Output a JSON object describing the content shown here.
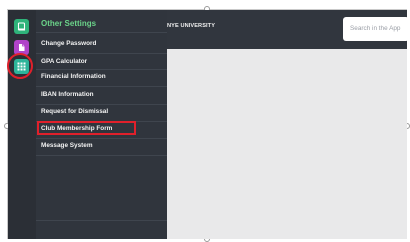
{
  "topbar": {
    "university_name": "NYE UNIVERSITY",
    "search_placeholder": "Search in the App"
  },
  "rail": {
    "buttons": [
      {
        "icon": "book-icon",
        "color": "#2fb37a"
      },
      {
        "icon": "document-icon",
        "color": "#b044c9"
      },
      {
        "icon": "apps-grid-icon",
        "color": "#2db59a",
        "highlighted": true
      }
    ]
  },
  "menu": {
    "header": "Other Settings",
    "items": [
      {
        "label": "Change Password"
      },
      {
        "label": "GPA Calculator"
      },
      {
        "label": "Financial Information"
      },
      {
        "label": "IBAN Information"
      },
      {
        "label": "Request for Dismissal"
      },
      {
        "label": "Club Membership Form",
        "highlighted": true
      },
      {
        "label": "Message System"
      }
    ]
  },
  "colors": {
    "rail_bg": "#2b2f36",
    "menu_bg": "#30353d",
    "header_accent": "#6bd48a",
    "highlight": "#e0202b",
    "content_bg": "#e9e9ea"
  }
}
